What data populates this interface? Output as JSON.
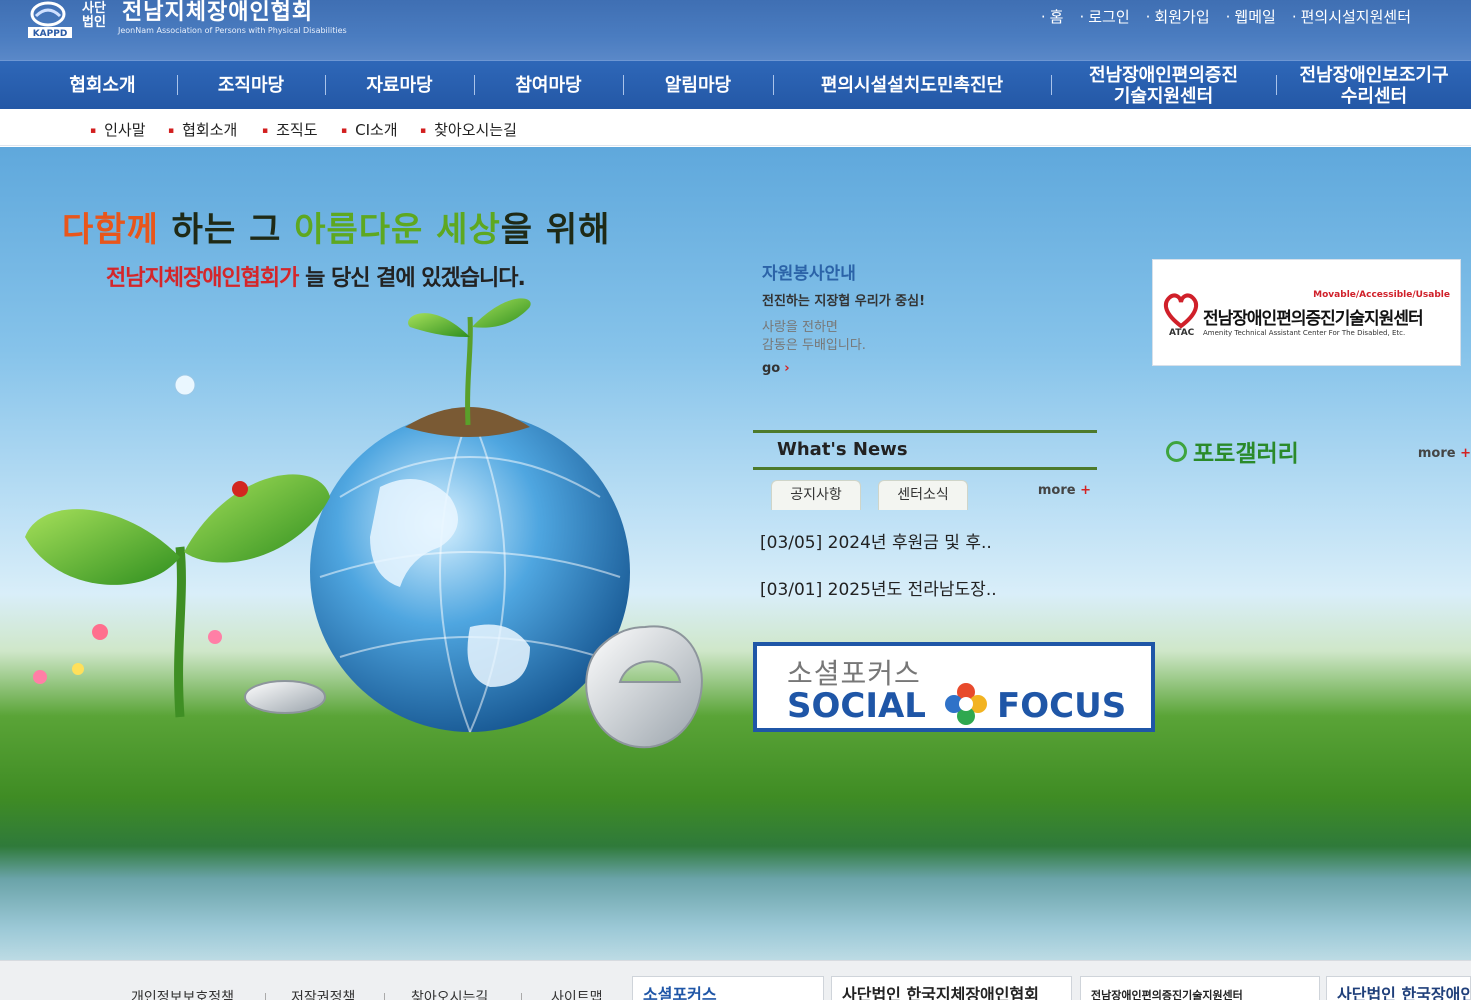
{
  "header": {
    "logo": {
      "corp_label": "사단 법인",
      "org_name": "전남지체장애인협회",
      "org_name_en": "JeonNam Association of Persons with Physical Disabilities",
      "mark_text": "KAPPD"
    },
    "utility_links": [
      "홈",
      "로그인",
      "회원가입",
      "웹메일",
      "편의시설지원센터"
    ]
  },
  "main_nav": [
    {
      "label": "협회소개",
      "active": true
    },
    {
      "label": "조직마당"
    },
    {
      "label": "자료마당"
    },
    {
      "label": "참여마당"
    },
    {
      "label": "알림마당"
    },
    {
      "label": "편의시설설치도민촉진단"
    },
    {
      "label": "전남장애인편의증진\n기술지원센터"
    },
    {
      "label": "전남장애인보조기구\n수리센터"
    }
  ],
  "sub_nav": [
    "인사말",
    "협회소개",
    "조직도",
    "CI소개",
    "찾아오시는길"
  ],
  "hero": {
    "slogan_line1": {
      "p1": "다함께",
      "p2": " 하는 그 ",
      "p3": "아름다운",
      "p4": " ",
      "p5": "세상",
      "p6": "을 위해"
    },
    "slogan_line2": {
      "org": "전남지체장애인협회가",
      "rest": " 늘 당신 곁에 있겠습니다."
    }
  },
  "volunteer": {
    "title": "자원봉사안내",
    "subtitle": "전진하는 지장협 우리가 중심!",
    "body_line1": "사랑을 전하면",
    "body_line2": "감동은 두배입니다.",
    "go_label": "go"
  },
  "news": {
    "title": "What's News",
    "tabs": [
      "공지사항",
      "센터소식"
    ],
    "more_label": "more",
    "items": [
      {
        "date": "[03/05]",
        "title": "2024년 후원금 및 후.."
      },
      {
        "date": "[03/01]",
        "title": "2025년도 전라남도장.."
      }
    ]
  },
  "social_focus": {
    "korean": "소셜포커스",
    "english_left": "SOCIAL",
    "english_right": "FOCUS"
  },
  "atac_banner": {
    "tagline": "Movable/Accessible/Usable",
    "name": "전남장애인편의증진기술지원센터",
    "abbr": "ATAC",
    "english": "Amenity Technical Assistant Center For The Disabled, Etc."
  },
  "gallery": {
    "title": "포토갤러리",
    "more_label": "more"
  },
  "footer": {
    "links": [
      "개인정보보호정책",
      "저작권정책",
      "찾아오시는길",
      "사이트맵"
    ],
    "banners": [
      "소셜포커스",
      "사단법인 한국지체장애인협회",
      "전남장애인편의증진기술지원센터",
      "사단법인 한국장애인"
    ]
  },
  "colors": {
    "header_blue": "#3f6fb3",
    "nav_blue": "#2458a6",
    "news_rule_green": "#4d7a2c",
    "accent_red": "#d42222",
    "social_blue": "#1f56a7"
  }
}
